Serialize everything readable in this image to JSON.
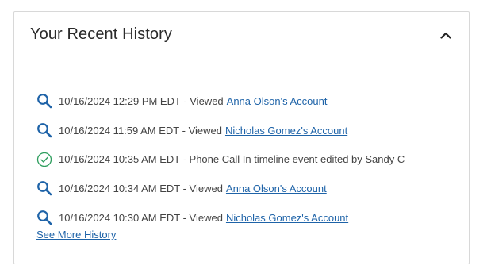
{
  "panel": {
    "title": "Your Recent History"
  },
  "history": [
    {
      "icon": "search-icon",
      "text": "10/16/2024 12:29 PM EDT - Viewed",
      "link": "Anna Olson's Account"
    },
    {
      "icon": "search-icon",
      "text": "10/16/2024 11:59 AM EDT - Viewed",
      "link": "Nicholas Gomez's Account"
    },
    {
      "icon": "check-circle-icon",
      "text": "10/16/2024 10:35 AM EDT - Phone Call In timeline event edited by Sandy C",
      "link": ""
    },
    {
      "icon": "search-icon",
      "text": "10/16/2024 10:34 AM EDT - Viewed",
      "link": "Anna Olson's Account"
    },
    {
      "icon": "search-icon",
      "text": "10/16/2024 10:30 AM EDT - Viewed",
      "link": "Nicholas Gomez's Account"
    }
  ],
  "footer": {
    "see_more_label": "See More History"
  },
  "colors": {
    "link": "#1e63a8",
    "search_icon": "#1e63a8",
    "check_icon": "#2e9e5e"
  }
}
